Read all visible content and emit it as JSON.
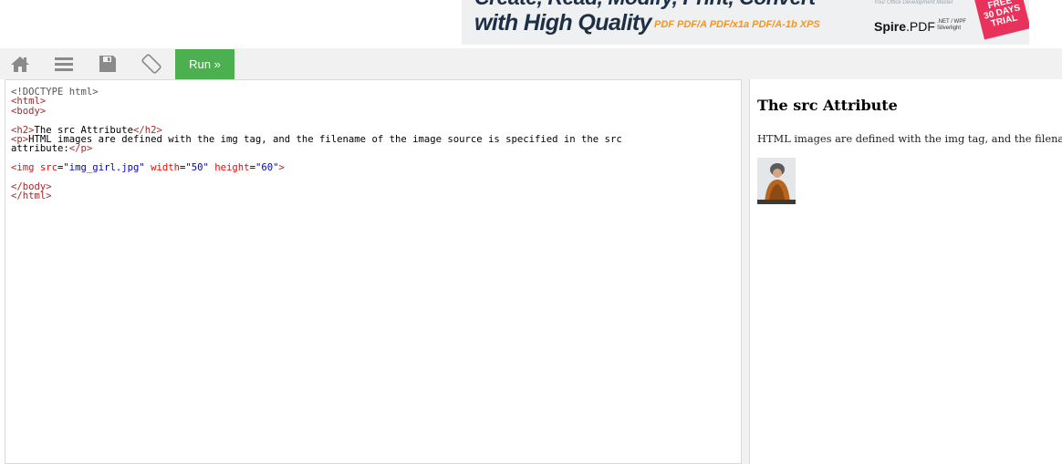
{
  "ad": {
    "headline_top": "Create, Read, Modify, Print, Convert",
    "headline_bottom": "with High Quality",
    "formats": "PDF PDF/A PDF/x1a PDF/A-1b XPS",
    "tagline": "Your Office Development Master",
    "logo_bold": "Spire",
    "logo_rest": ".PDF",
    "logo_sub1": ".NET / WPF",
    "logo_sub2": "Silverlight",
    "badge_line1": "FREE",
    "badge_line2": "30 DAYS",
    "badge_line3": "TRIAL",
    "brand_color": "#1e2f45",
    "accent_color": "#f7941d",
    "badge_color": "#e8315b"
  },
  "toolbar": {
    "icons": [
      "home-icon",
      "menu-icon",
      "save-icon",
      "rotate-icon"
    ],
    "run_label": "Run »",
    "run_color": "#4caf50"
  },
  "editor": {
    "lines": {
      "l1": "<!DOCTYPE html>",
      "l2_tag": "<html>",
      "l3_tag": "<body>",
      "l5_open": "<h2>",
      "l5_text": "The src Attribute",
      "l5_close": "</h2>",
      "l6_open": "<p>",
      "l6_text": "HTML images are defined with the img tag, and the filename of the image source is specified in the src",
      "l7_text": "attribute:",
      "l7_close": "</p>",
      "l9_open": "<img ",
      "l9_attr1": "src",
      "l9_val1": "\"img_girl.jpg\"",
      "l9_attr2": "width",
      "l9_val2": "\"50\"",
      "l9_attr3": "height",
      "l9_val3": "\"60\"",
      "l9_close": ">",
      "l11_tag": "</body>",
      "l12_tag": "</html>"
    }
  },
  "result": {
    "heading": "The src Attribute",
    "paragraph": "HTML images are defined with the img tag, and the filename of the image source is specified in the src attribute:",
    "image_label": "img_girl.jpg"
  }
}
